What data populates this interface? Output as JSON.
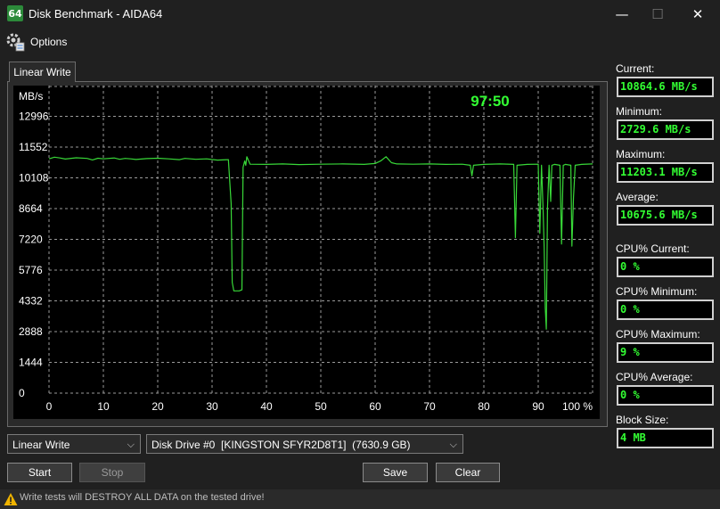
{
  "window": {
    "title": "Disk Benchmark - AIDA64",
    "app_icon_text": "64",
    "minimize": "—",
    "maximize": "☐",
    "close": "✕"
  },
  "menu": {
    "options_label": "Options"
  },
  "tabs": [
    {
      "label": "Linear Write",
      "active": true
    }
  ],
  "chart_data": {
    "type": "line",
    "ylabel": "MB/s",
    "elapsed": "97:50",
    "y_ticks": [
      "12996",
      "11552",
      "10108",
      "8664",
      "7220",
      "5776",
      "4332",
      "2888",
      "1444",
      "0"
    ],
    "x_ticks": [
      "0",
      "10",
      "20",
      "30",
      "40",
      "50",
      "60",
      "70",
      "80",
      "90",
      "100 %"
    ],
    "xlim": [
      0,
      100
    ],
    "ylim": [
      0,
      14440
    ],
    "grid": true,
    "series_color": "#38d838",
    "series": [
      {
        "values": [
          [
            0,
            11000
          ],
          [
            1,
            11080
          ],
          [
            2,
            11040
          ],
          [
            3,
            10990
          ],
          [
            5,
            11050
          ],
          [
            7,
            11020
          ],
          [
            8,
            10950
          ],
          [
            9,
            11030
          ],
          [
            10,
            11000
          ],
          [
            12,
            11040
          ],
          [
            13,
            10980
          ],
          [
            14,
            11020
          ],
          [
            15,
            11000
          ],
          [
            16,
            10970
          ],
          [
            18,
            11010
          ],
          [
            20,
            11030
          ],
          [
            22,
            11000
          ],
          [
            24,
            10960
          ],
          [
            25,
            11020
          ],
          [
            27,
            10980
          ],
          [
            29,
            11000
          ],
          [
            31,
            10940
          ],
          [
            33,
            10960
          ],
          [
            33.5,
            8900
          ],
          [
            33.7,
            5200
          ],
          [
            34,
            4800
          ],
          [
            35,
            4800
          ],
          [
            35.5,
            4850
          ],
          [
            35.7,
            10600
          ],
          [
            36,
            10900
          ],
          [
            36.2,
            10700
          ],
          [
            36.4,
            11100
          ],
          [
            37,
            10750
          ],
          [
            40,
            10740
          ],
          [
            43,
            10760
          ],
          [
            46,
            10730
          ],
          [
            50,
            10750
          ],
          [
            54,
            10760
          ],
          [
            58,
            10740
          ],
          [
            60,
            10780
          ],
          [
            61,
            10900
          ],
          [
            62,
            11100
          ],
          [
            63,
            10820
          ],
          [
            64,
            10760
          ],
          [
            67,
            10750
          ],
          [
            70,
            10760
          ],
          [
            73,
            10740
          ],
          [
            76,
            10750
          ],
          [
            77.5,
            10700
          ],
          [
            77.8,
            10200
          ],
          [
            78.1,
            10700
          ],
          [
            80,
            10740
          ],
          [
            83,
            10760
          ],
          [
            85.5,
            10740
          ],
          [
            85.8,
            7300
          ],
          [
            86.1,
            10700
          ],
          [
            88,
            10740
          ],
          [
            90,
            10750
          ],
          [
            90.3,
            7500
          ],
          [
            90.6,
            10700
          ],
          [
            90.9,
            8600
          ],
          [
            91.1,
            6800
          ],
          [
            91.3,
            4000
          ],
          [
            91.5,
            3000
          ],
          [
            91.7,
            8700
          ],
          [
            92,
            10700
          ],
          [
            92.3,
            9000
          ],
          [
            92.5,
            10700
          ],
          [
            93,
            10740
          ],
          [
            94,
            10700
          ],
          [
            94.3,
            7000
          ],
          [
            94.6,
            10700
          ],
          [
            95,
            10740
          ],
          [
            96,
            10700
          ],
          [
            96.2,
            6900
          ],
          [
            96.5,
            9200
          ],
          [
            96.8,
            10700
          ],
          [
            98,
            10740
          ],
          [
            100,
            10760
          ]
        ]
      }
    ]
  },
  "stats": {
    "current_label": "Current:",
    "current_value": "10864.6 MB/s",
    "minimum_label": "Minimum:",
    "minimum_value": "2729.6 MB/s",
    "maximum_label": "Maximum:",
    "maximum_value": "11203.1 MB/s",
    "average_label": "Average:",
    "average_value": "10675.6 MB/s",
    "cpu_current_label": "CPU% Current:",
    "cpu_current_value": "0 %",
    "cpu_minimum_label": "CPU% Minimum:",
    "cpu_minimum_value": "0 %",
    "cpu_maximum_label": "CPU% Maximum:",
    "cpu_maximum_value": "9 %",
    "cpu_average_label": "CPU% Average:",
    "cpu_average_value": "0 %",
    "block_size_label": "Block Size:",
    "block_size_value": "4 MB"
  },
  "controls": {
    "test_select": "Linear Write",
    "drive_select": "Disk Drive #0  [KINGSTON SFYR2D8T1]  (7630.9 GB)",
    "start": "Start",
    "stop": "Stop",
    "save": "Save",
    "clear": "Clear"
  },
  "status": {
    "warning": "Write tests will DESTROY ALL DATA on the tested drive!"
  },
  "colors": {
    "accent_green": "#33ff33",
    "background": "#202020",
    "chart_bg": "#000000"
  }
}
